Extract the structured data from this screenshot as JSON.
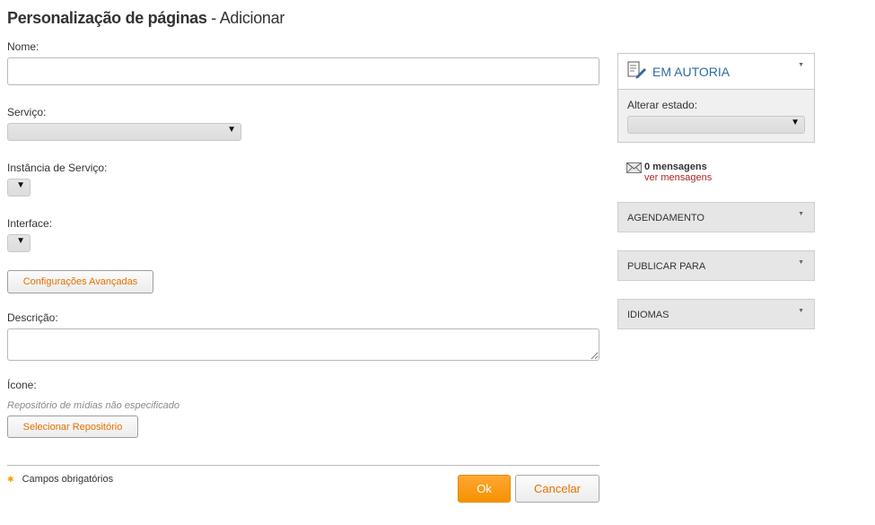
{
  "header": {
    "title": "Personalização de páginas",
    "subtitle": "- Adicionar"
  },
  "form": {
    "name_label": "Nome:",
    "name_value": "",
    "service_label": "Serviço:",
    "service_value": "",
    "service_instance_label": "Instância de Serviço:",
    "service_instance_value": "",
    "interface_label": "Interface:",
    "interface_value": "",
    "advanced_button": "Configurações Avançadas",
    "description_label": "Descrição:",
    "description_value": "",
    "icon_label": "Ícone:",
    "icon_hint": "Repositório de mídias não especificado",
    "select_repo_button": "Selecionar Repositório",
    "required_note": "Campos obrigatórios",
    "ok_button": "Ok",
    "cancel_button": "Cancelar"
  },
  "sidebar": {
    "status_panel": {
      "title": "EM AUTORIA",
      "change_state_label": "Alterar estado:",
      "state_value": ""
    },
    "messages": {
      "count_text": "0 mensagens",
      "link_text": "ver mensagens"
    },
    "sections": [
      {
        "label": "AGENDAMENTO"
      },
      {
        "label": "PUBLICAR PARA"
      },
      {
        "label": "IDIOMAS"
      }
    ]
  },
  "icons": {
    "status": "document-edit-icon",
    "messages": "envelope-icon",
    "dropdown": "triangle-down-icon",
    "required": "asterisk-icon"
  },
  "colors": {
    "accent_orange": "#f79200",
    "link_orange": "#e76f00",
    "status_blue": "#2f6aa0",
    "link_red": "#b22222"
  }
}
